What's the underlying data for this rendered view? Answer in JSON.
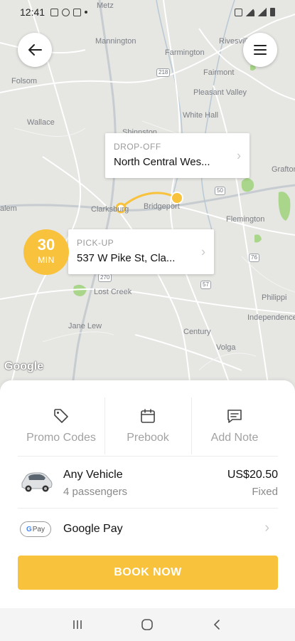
{
  "status_bar": {
    "time": "12:41",
    "left_icons": [
      "image-icon",
      "notification-icon",
      "notification-icon",
      "dot-icon"
    ],
    "right_icons": [
      "mute-icon",
      "wifi-icon",
      "signal-icon",
      "battery-icon"
    ]
  },
  "map": {
    "labels": [
      "Metz",
      "Mannington",
      "Farmington",
      "Rivesville",
      "Folsom",
      "Fairmont",
      "Pleasant Valley",
      "White Hall",
      "Wallace",
      "Shinnston",
      "Grafton",
      "alem",
      "Clarksburg",
      "Bridgeport",
      "Flemington",
      "Lost Creek",
      "Philippi",
      "Independence",
      "Jane Lew",
      "Century",
      "Volga"
    ],
    "route_shields": [
      "218",
      "50",
      "76",
      "270",
      "57"
    ],
    "google_logo_text": "Google"
  },
  "dropoff": {
    "label": "DROP-OFF",
    "address": "North Central Wes..."
  },
  "pickup": {
    "label": "PICK-UP",
    "address": "537 W Pike St, Cla..."
  },
  "eta": {
    "value": "30",
    "unit": "MIN"
  },
  "options": {
    "promo_label": "Promo Codes",
    "prebook_label": "Prebook",
    "note_label": "Add Note"
  },
  "vehicle": {
    "name": "Any Vehicle",
    "capacity": "4 passengers",
    "price": "US$20.50",
    "fare_type": "Fixed"
  },
  "payment": {
    "badge_g": "G",
    "badge_text": "Pay",
    "method": "Google Pay"
  },
  "book_button": "BOOK NOW",
  "colors": {
    "accent": "#f9c23c",
    "map_background": "#e6e6e3",
    "map_road": "#ffffff",
    "map_water": "#9ec0d6",
    "map_park": "#a9d68a"
  }
}
